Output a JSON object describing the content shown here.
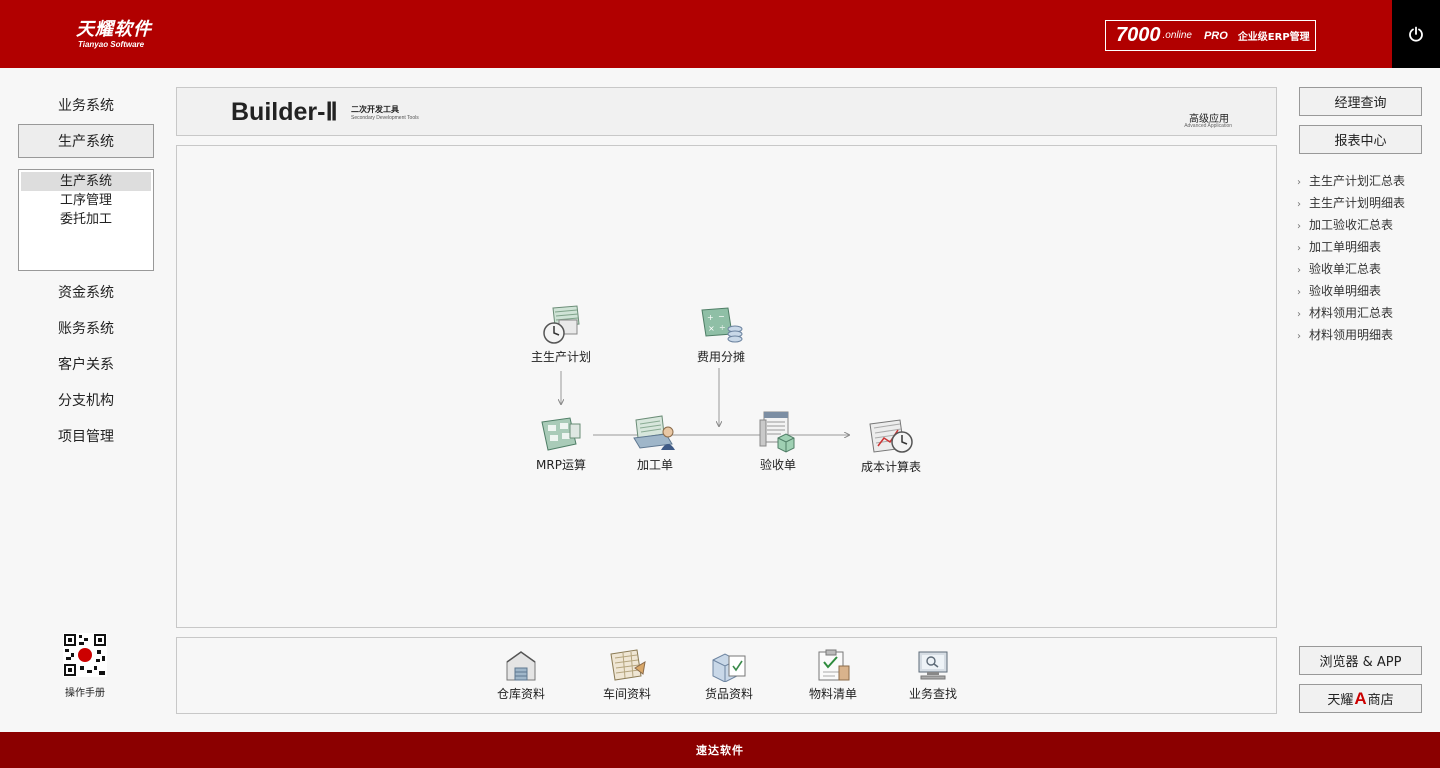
{
  "header": {
    "brand_cn": "天耀软件",
    "brand_en": "Tianyao Software",
    "product_number": "7000",
    "product_online": ".online",
    "product_pro": "PRO",
    "product_desc": "企业级ERP管理"
  },
  "left_nav": {
    "items": [
      "业务系统",
      "生产系统",
      "资金系统",
      "账务系统",
      "客户关系",
      "分支机构",
      "项目管理"
    ],
    "active": "生产系统",
    "sub_items": [
      "生产系统",
      "工序管理",
      "委托加工"
    ],
    "sub_selected": "生产系统",
    "manual_label": "操作手册"
  },
  "banner": {
    "title": "Builder-Ⅱ",
    "subtitle_cn": "二次开发工具",
    "subtitle_en": "Secondary Development Tools",
    "advanced_cn": "高级应用",
    "advanced_en": "Advanced Application"
  },
  "flow": {
    "nodes": [
      "主生产计划",
      "费用分摊",
      "MRP运算",
      "加工单",
      "验收单",
      "成本计算表"
    ]
  },
  "bottom_tools": [
    "仓库资料",
    "车间资料",
    "货品资料",
    "物料清单",
    "业务查找"
  ],
  "right_panel": {
    "manager_query": "经理查询",
    "report_center": "报表中心",
    "reports": [
      "主生产计划汇总表",
      "主生产计划明细表",
      "加工验收汇总表",
      "加工单明细表",
      "验收单汇总表",
      "验收单明细表",
      "材料领用汇总表",
      "材料领用明细表"
    ],
    "browser_app": "浏览器 & APP",
    "shop_prefix": "天耀",
    "shop_letter": "A",
    "shop_suffix": "商店"
  },
  "footer": {
    "text": "速达软件"
  },
  "colors": {
    "header_red": "#b10000",
    "footer_red": "#8b0000",
    "power_bg": "#000000"
  }
}
